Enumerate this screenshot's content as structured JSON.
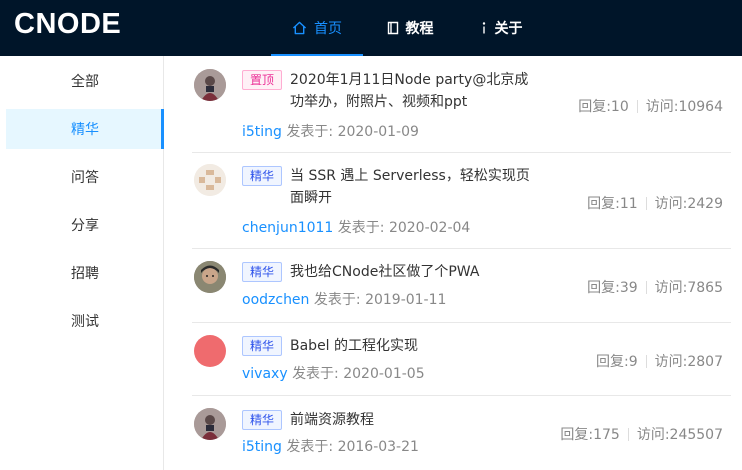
{
  "header": {
    "logo": "CNODE",
    "nav": [
      {
        "label": "首页",
        "icon": "home-icon"
      },
      {
        "label": "教程",
        "icon": "book-icon"
      },
      {
        "label": "关于",
        "icon": "info-icon"
      }
    ]
  },
  "sidebar": {
    "items": [
      {
        "label": "全部"
      },
      {
        "label": "精华"
      },
      {
        "label": "问答"
      },
      {
        "label": "分享"
      },
      {
        "label": "招聘"
      },
      {
        "label": "测试"
      }
    ],
    "active": "精华"
  },
  "topics": [
    {
      "tag": "置顶",
      "title": "2020年1月11日Node party@北京成功举办，附照片、视频和ppt",
      "author": "i5ting",
      "posted_label": "发表于:",
      "date": "2020-01-09",
      "replies": "回复:10",
      "visits": "访问:10964",
      "avatar_icon": "user-avatar-photo"
    },
    {
      "tag": "精华",
      "title": "当 SSR 遇上 Serverless，轻松实现页面瞬开",
      "author": "chenjun1011",
      "posted_label": "发表于:",
      "date": "2020-02-04",
      "replies": "回复:11",
      "visits": "访问:2429",
      "avatar_icon": "user-avatar-pattern"
    },
    {
      "tag": "精华",
      "title": "我也给CNode社区做了个PWA",
      "author": "oodzchen",
      "posted_label": "发表于:",
      "date": "2019-01-11",
      "replies": "回复:39",
      "visits": "访问:7865",
      "avatar_icon": "user-avatar-photo"
    },
    {
      "tag": "精华",
      "title": "Babel 的工程化实现",
      "author": "vivaxy",
      "posted_label": "发表于:",
      "date": "2020-01-05",
      "replies": "回复:9",
      "visits": "访问:2807",
      "avatar_icon": "user-avatar-red"
    },
    {
      "tag": "精华",
      "title": "前端资源教程",
      "author": "i5ting",
      "posted_label": "发表于:",
      "date": "2016-03-21",
      "replies": "回复:175",
      "visits": "访问:245507",
      "avatar_icon": "user-avatar-photo"
    }
  ],
  "colors": {
    "header_bg": "#001529",
    "accent": "#1890ff",
    "tag_good": "#2f54eb",
    "tag_top": "#eb2f96"
  }
}
